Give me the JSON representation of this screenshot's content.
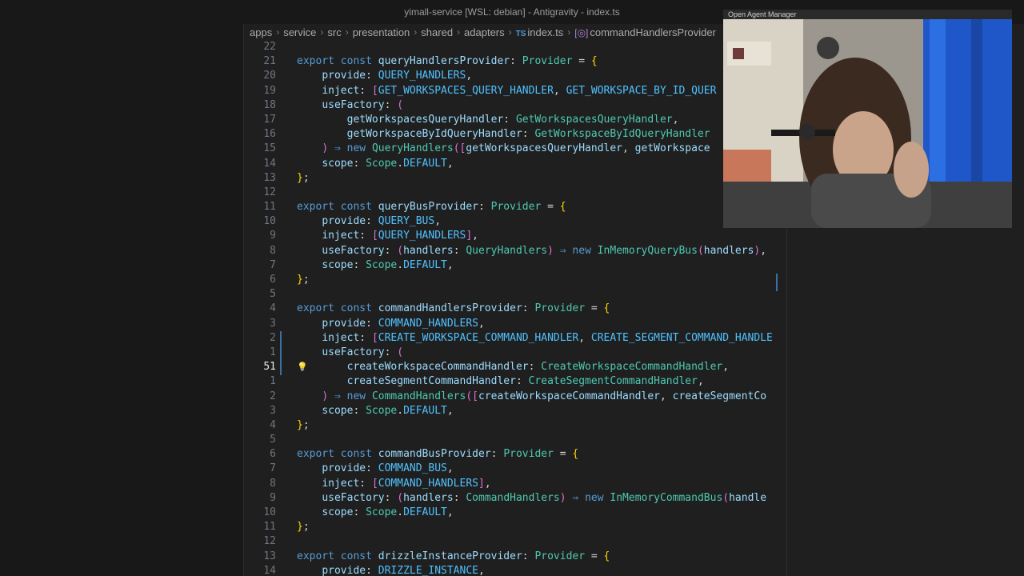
{
  "window": {
    "title": "yimall-service [WSL: debian] - Antigravity - index.ts"
  },
  "breadcrumb": {
    "items": [
      "apps",
      "service",
      "src",
      "presentation",
      "shared",
      "adapters"
    ],
    "file": "index.ts",
    "file_badge": "TS",
    "symbol": "commandHandlersProvider"
  },
  "editor": {
    "current_line": "51",
    "lines": [
      {
        "n": "22",
        "text": ""
      },
      {
        "n": "21",
        "text": "export const queryHandlersProvider: Provider = {"
      },
      {
        "n": "20",
        "text": "    provide: QUERY_HANDLERS,"
      },
      {
        "n": "19",
        "text": "    inject: [GET_WORKSPACES_QUERY_HANDLER, GET_WORKSPACE_BY_ID_QUER"
      },
      {
        "n": "18",
        "text": "    useFactory: ("
      },
      {
        "n": "17",
        "text": "        getWorkspacesQueryHandler: GetWorkspacesQueryHandler,"
      },
      {
        "n": "16",
        "text": "        getWorkspaceByIdQueryHandler: GetWorkspaceByIdQueryHandler"
      },
      {
        "n": "15",
        "text": "    ) ⇒ new QueryHandlers([getWorkspacesQueryHandler, getWorkspace"
      },
      {
        "n": "14",
        "text": "    scope: Scope.DEFAULT,"
      },
      {
        "n": "13",
        "text": "};"
      },
      {
        "n": "12",
        "text": ""
      },
      {
        "n": "11",
        "text": "export const queryBusProvider: Provider = {"
      },
      {
        "n": "10",
        "text": "    provide: QUERY_BUS,"
      },
      {
        "n": "9",
        "text": "    inject: [QUERY_HANDLERS],"
      },
      {
        "n": "8",
        "text": "    useFactory: (handlers: QueryHandlers) ⇒ new InMemoryQueryBus(handlers),"
      },
      {
        "n": "7",
        "text": "    scope: Scope.DEFAULT,"
      },
      {
        "n": "6",
        "text": "};"
      },
      {
        "n": "5",
        "text": ""
      },
      {
        "n": "4",
        "text": "export const commandHandlersProvider: Provider = {"
      },
      {
        "n": "3",
        "text": "    provide: COMMAND_HANDLERS,"
      },
      {
        "n": "2",
        "text": "    inject: [CREATE_WORKSPACE_COMMAND_HANDLER, CREATE_SEGMENT_COMMAND_HANDLE"
      },
      {
        "n": "1",
        "text": "    useFactory: ("
      },
      {
        "n": "51",
        "text": "        createWorkspaceCommandHandler: CreateWorkspaceCommandHandler,"
      },
      {
        "n": "1",
        "text": "        createSegmentCommandHandler: CreateSegmentCommandHandler,"
      },
      {
        "n": "2",
        "text": "    ) ⇒ new CommandHandlers([createWorkspaceCommandHandler, createSegmentCo"
      },
      {
        "n": "3",
        "text": "    scope: Scope.DEFAULT,"
      },
      {
        "n": "4",
        "text": "};"
      },
      {
        "n": "5",
        "text": ""
      },
      {
        "n": "6",
        "text": "export const commandBusProvider: Provider = {"
      },
      {
        "n": "7",
        "text": "    provide: COMMAND_BUS,"
      },
      {
        "n": "8",
        "text": "    inject: [COMMAND_HANDLERS],"
      },
      {
        "n": "9",
        "text": "    useFactory: (handlers: CommandHandlers) ⇒ new InMemoryCommandBus(handle"
      },
      {
        "n": "10",
        "text": "    scope: Scope.DEFAULT,"
      },
      {
        "n": "11",
        "text": "};"
      },
      {
        "n": "12",
        "text": ""
      },
      {
        "n": "13",
        "text": "export const drizzleInstanceProvider: Provider = {"
      },
      {
        "n": "14",
        "text": "    provide: DRIZZLE_INSTANCE,"
      }
    ]
  },
  "webcam": {
    "overlay_text": "Open Agent Manager"
  }
}
